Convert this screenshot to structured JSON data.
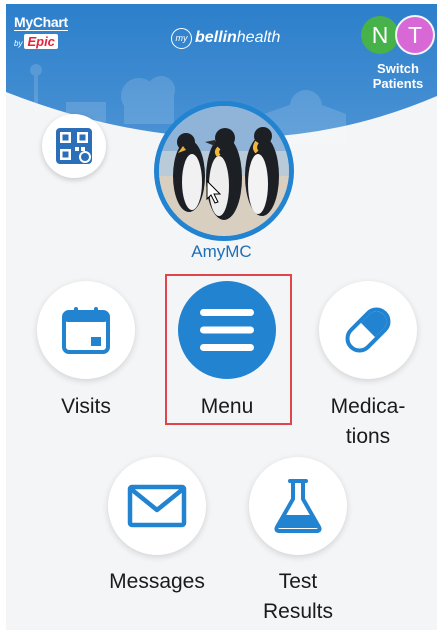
{
  "header": {
    "mychart_logo": {
      "line1": "MyChart",
      "by": "by",
      "brand": "Epic"
    },
    "bellin_logo": {
      "prefix": "my",
      "brand_bold": "bellin",
      "brand_light": "health"
    },
    "switch_patients": {
      "avatars": [
        "N",
        "T"
      ],
      "label_line1": "Switch",
      "label_line2": "Patients"
    },
    "colors": {
      "header_blue": "#2c7fcb",
      "accent_blue": "#2283d1",
      "chip_n": "#47b24a",
      "chip_t": "#d868d6"
    }
  },
  "profile": {
    "name": "AmyMC"
  },
  "tiles": {
    "visits": {
      "label": "Visits",
      "icon": "calendar-icon"
    },
    "menu": {
      "label": "Menu",
      "icon": "hamburger-menu-icon",
      "highlighted": true
    },
    "medications": {
      "label_line1": "Medica-",
      "label_line2": "tions",
      "icon": "pill-capsule-icon"
    },
    "messages": {
      "label": "Messages",
      "icon": "envelope-icon"
    },
    "test_results": {
      "label_line1": "Test",
      "label_line2": "Results",
      "icon": "flask-icon"
    }
  },
  "highlight_color": "#e0454c"
}
